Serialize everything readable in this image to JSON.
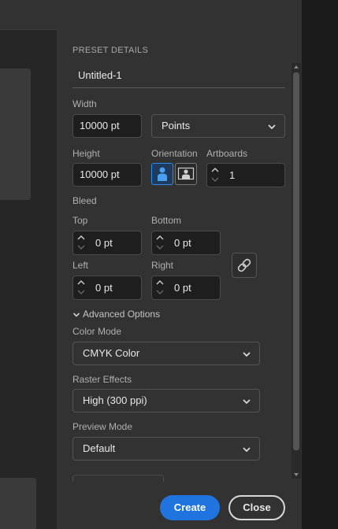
{
  "panel": {
    "section_title": "PRESET DETAILS",
    "document_name": "Untitled-1",
    "width": {
      "label": "Width",
      "value": "10000 pt"
    },
    "units": {
      "selected": "Points"
    },
    "height": {
      "label": "Height",
      "value": "10000 pt"
    },
    "orientation": {
      "label": "Orientation",
      "selected": "portrait"
    },
    "artboards": {
      "label": "Artboards",
      "value": "1"
    },
    "bleed": {
      "label": "Bleed",
      "top": {
        "label": "Top",
        "value": "0 pt"
      },
      "bottom": {
        "label": "Bottom",
        "value": "0 pt"
      },
      "left": {
        "label": "Left",
        "value": "0 pt"
      },
      "right": {
        "label": "Right",
        "value": "0 pt"
      },
      "link_icon": "link-icon"
    },
    "advanced_options": {
      "label": "Advanced Options",
      "expanded": true
    },
    "color_mode": {
      "label": "Color Mode",
      "selected": "CMYK Color"
    },
    "raster_effects": {
      "label": "Raster Effects",
      "selected": "High (300 ppi)"
    },
    "preview_mode": {
      "label": "Preview Mode",
      "selected": "Default"
    }
  },
  "actions": {
    "create_label": "Create",
    "close_label": "Close"
  },
  "colors": {
    "accent": "#1f74e0",
    "panel_bg": "#323232",
    "field_bg": "#1e1e1e"
  }
}
